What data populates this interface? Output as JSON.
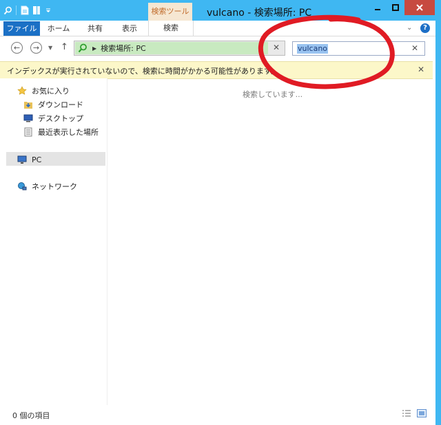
{
  "window": {
    "title": "vulcano - 検索場所: PC",
    "context_tab_header": "検索ツール",
    "minimize_icon": "minimize-icon",
    "maximize_icon": "maximize-icon",
    "close_icon": "close-icon",
    "titlebar_color": "#3fb7f2",
    "close_color": "#c74a40"
  },
  "ribbon": {
    "tabs": [
      {
        "label": "ファイル"
      },
      {
        "label": "ホーム"
      },
      {
        "label": "共有"
      },
      {
        "label": "表示"
      },
      {
        "label": "検索"
      }
    ],
    "file_tab_color": "#1b70c5",
    "help_label": "?"
  },
  "nav": {
    "address_text": "検索場所: PC",
    "address_highlight_color": "#c8eac0",
    "search_value": "vulcano",
    "search_highlight_color": "#99c3f0"
  },
  "info_bar": {
    "text": "インデックスが実行されていないので、検索に時間がかかる可能性があります。",
    "color": "#fcf7c9"
  },
  "navpane": {
    "favorites": "お気に入り",
    "favorites_items": [
      {
        "label": "ダウンロード",
        "icon": "download-folder-icon"
      },
      {
        "label": "デスクトップ",
        "icon": "desktop-icon"
      },
      {
        "label": "最近表示した場所",
        "icon": "recent-places-icon"
      }
    ],
    "pc": "PC",
    "network": "ネットワーク"
  },
  "content": {
    "status_text": "検索しています..."
  },
  "statusbar": {
    "item_count": "0 個の項目"
  },
  "annotation": {
    "color": "#e01b24"
  }
}
